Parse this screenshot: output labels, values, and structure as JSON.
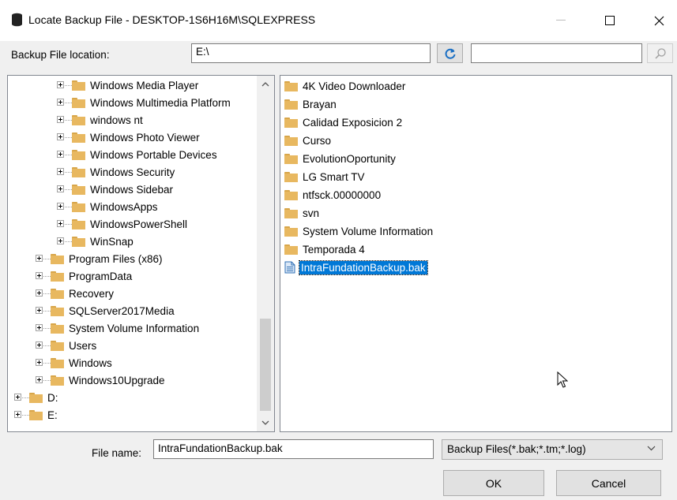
{
  "window": {
    "title": "Locate Backup File - DESKTOP-1S6H16M\\SQLEXPRESS",
    "icon": "database-icon"
  },
  "location": {
    "label": "Backup File location:",
    "value": "E:\\",
    "search_value": ""
  },
  "tree": {
    "items": [
      {
        "label": "Windows Media Player",
        "level": 2
      },
      {
        "label": "Windows Multimedia Platform",
        "level": 2
      },
      {
        "label": "windows nt",
        "level": 2
      },
      {
        "label": "Windows Photo Viewer",
        "level": 2
      },
      {
        "label": "Windows Portable Devices",
        "level": 2
      },
      {
        "label": "Windows Security",
        "level": 2
      },
      {
        "label": "Windows Sidebar",
        "level": 2
      },
      {
        "label": "WindowsApps",
        "level": 2
      },
      {
        "label": "WindowsPowerShell",
        "level": 2
      },
      {
        "label": "WinSnap",
        "level": 2
      },
      {
        "label": "Program Files (x86)",
        "level": 1
      },
      {
        "label": "ProgramData",
        "level": 1
      },
      {
        "label": "Recovery",
        "level": 1
      },
      {
        "label": "SQLServer2017Media",
        "level": 1
      },
      {
        "label": "System Volume Information",
        "level": 1
      },
      {
        "label": "Users",
        "level": 1
      },
      {
        "label": "Windows",
        "level": 1
      },
      {
        "label": "Windows10Upgrade",
        "level": 1
      },
      {
        "label": "D:",
        "level": 0
      },
      {
        "label": "E:",
        "level": 0
      }
    ]
  },
  "files": {
    "items": [
      {
        "label": "4K Video Downloader",
        "type": "folder"
      },
      {
        "label": "Brayan",
        "type": "folder"
      },
      {
        "label": "Calidad Exposicion 2",
        "type": "folder"
      },
      {
        "label": "Curso",
        "type": "folder"
      },
      {
        "label": "EvolutionOportunity",
        "type": "folder"
      },
      {
        "label": "LG Smart TV",
        "type": "folder"
      },
      {
        "label": "ntfsck.00000000",
        "type": "folder"
      },
      {
        "label": "svn",
        "type": "folder"
      },
      {
        "label": "System Volume Information",
        "type": "folder"
      },
      {
        "label": "Temporada 4",
        "type": "folder"
      },
      {
        "label": "IntraFundationBackup.bak",
        "type": "file",
        "selected": true
      }
    ]
  },
  "footer": {
    "filename_label": "File name:",
    "filename_value": "IntraFundationBackup.bak",
    "filetype_value": "Backup Files(*.bak;*.tm;*.log)",
    "ok_label": "OK",
    "cancel_label": "Cancel"
  },
  "colors": {
    "selection": "#0078d7",
    "folder": "#e8b860",
    "refresh_icon": "#1a6fc4"
  }
}
